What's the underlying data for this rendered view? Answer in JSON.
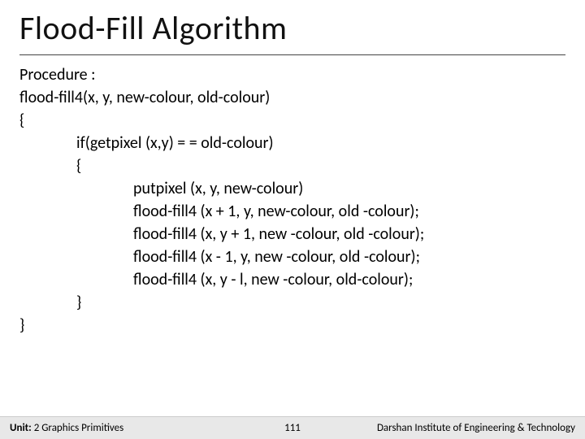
{
  "title": "Flood-Fill Algorithm",
  "lines": {
    "l0": "Procedure :",
    "l1": "flood-fill4(x, y, new-colour, old-colour)",
    "l2": "{",
    "l3": "if(getpixel (x,y) = = old-colour)",
    "l4": "{",
    "l5": "putpixel (x, y, new-colour)",
    "l6": "flood-fill4 (x + 1, y, new-colour, old -colour);",
    "l7": "flood-fill4 (x, y + 1, new -colour, old -colour);",
    "l8": "flood-fill4 (x - 1, y, new -colour, old -colour);",
    "l9": "flood-fill4 (x, y - l, new -colour, old-colour);",
    "l10": "}",
    "l11": "}"
  },
  "footer": {
    "unit_label": "Unit: ",
    "unit_text": "2 Graphics Primitives",
    "page": "111",
    "institute": "Darshan Institute of Engineering & Technology"
  }
}
